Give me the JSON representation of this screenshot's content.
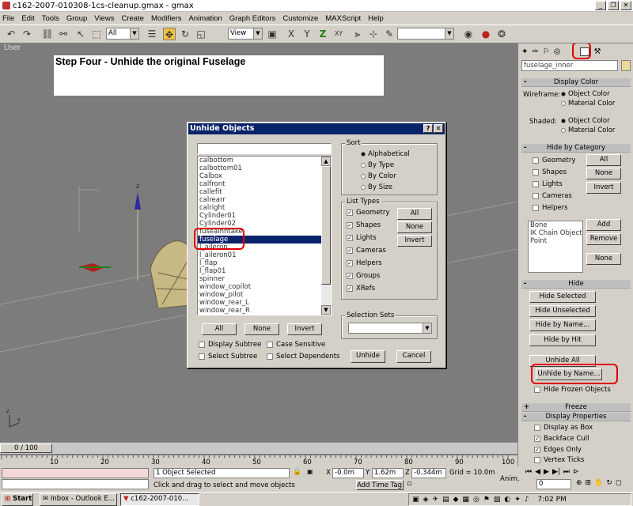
{
  "window": {
    "title": "c162-2007-010308-1cs-cleanup.gmax - gmax",
    "min": "_",
    "max": "❐",
    "close": "✕"
  },
  "menu": [
    "File",
    "Edit",
    "Tools",
    "Group",
    "Views",
    "Create",
    "Modifiers",
    "Animation",
    "Graph Editors",
    "Customize",
    "MAXScript",
    "Help"
  ],
  "toolbar": {
    "filter_value": "All",
    "view_value": "View"
  },
  "viewport": {
    "label": "User",
    "step_text": "Step Four - Unhide the original Fuselage"
  },
  "command_panel": {
    "object_name": "fuselage_inner",
    "display_color": {
      "header": "Display Color",
      "wireframe_label": "Wireframe:",
      "shaded_label": "Shaded:",
      "opt_object": "Object Color",
      "opt_material": "Material Color"
    },
    "hide_by_category": {
      "header": "Hide by Category",
      "items": [
        "Geometry",
        "Shapes",
        "Lights",
        "Cameras",
        "Helpers"
      ],
      "all": "All",
      "none": "None",
      "invert": "Invert",
      "list": [
        "Bone",
        "IK Chain Object",
        "Point"
      ],
      "add": "Add",
      "remove": "Remove",
      "none2": "None"
    },
    "hide": {
      "header": "Hide",
      "hide_selected": "Hide Selected",
      "hide_unselected": "Hide Unselected",
      "hide_by_name": "Hide by Name...",
      "hide_by_hit": "Hide by Hit",
      "unhide_all": "Unhide All",
      "unhide_by_name": "Unhide by Name...",
      "hide_frozen": "Hide Frozen Objects"
    },
    "freeze": {
      "header": "Freeze",
      "sign": "+"
    },
    "display_properties": {
      "header": "Display Properties",
      "sign": "-",
      "items": [
        {
          "label": "Display as Box",
          "checked": false
        },
        {
          "label": "Backface Cull",
          "checked": true
        },
        {
          "label": "Edges Only",
          "checked": true
        },
        {
          "label": "Vertex Ticks",
          "checked": false
        }
      ]
    }
  },
  "dialog": {
    "title": "Unhide Objects",
    "help": "?",
    "close": "✕",
    "search_value": "",
    "list": [
      "calbottom",
      "calbottom01",
      "Calbox",
      "calfront",
      "callefit",
      "calrearr",
      "calright",
      "Cylinder01",
      "Cylinder02",
      "fuseainntake",
      "fuselage",
      "l_aileron",
      "l_aileron01",
      "l_flap",
      "l_flap01",
      "spinner",
      "window_copilot",
      "window_pilot",
      "window_rear_L",
      "window_rear_R"
    ],
    "selected_index": 10,
    "sort": {
      "label": "Sort",
      "options": [
        "Alphabetical",
        "By Type",
        "By Color",
        "By Size"
      ],
      "selected": 0
    },
    "list_types": {
      "label": "List Types",
      "items": [
        "Geometry",
        "Shapes",
        "Lights",
        "Cameras",
        "Helpers",
        "Groups",
        "XRefs"
      ],
      "all": "All",
      "none": "None",
      "invert": "Invert"
    },
    "btn_all": "All",
    "btn_none": "None",
    "btn_invert": "Invert",
    "display_subtree": "Display Subtree",
    "case_sensitive": "Case Sensitive",
    "select_subtree": "Select Subtree",
    "select_dependents": "Select Dependents",
    "selection_sets": "Selection Sets",
    "unhide": "Unhide",
    "cancel": "Cancel"
  },
  "timeline": {
    "frame": "0 / 100",
    "ticks": [
      "10",
      "20",
      "30",
      "40",
      "50",
      "60",
      "70",
      "80",
      "90",
      "100"
    ]
  },
  "status": {
    "selected": "1 Object Selected",
    "prompt": "Click and drag to select and move objects",
    "x": "-0.0m",
    "y": "1.62m",
    "z": "-0.344m",
    "grid": "Grid = 10.0m",
    "add_time_tag": "Add Time Tag",
    "anim": "Anim.",
    "frame_field": "0"
  },
  "taskbar": {
    "start": "Start",
    "tasks": [
      "Inbox - Outlook E...",
      "c162-2007-010..."
    ],
    "time": "7:02 PM"
  }
}
